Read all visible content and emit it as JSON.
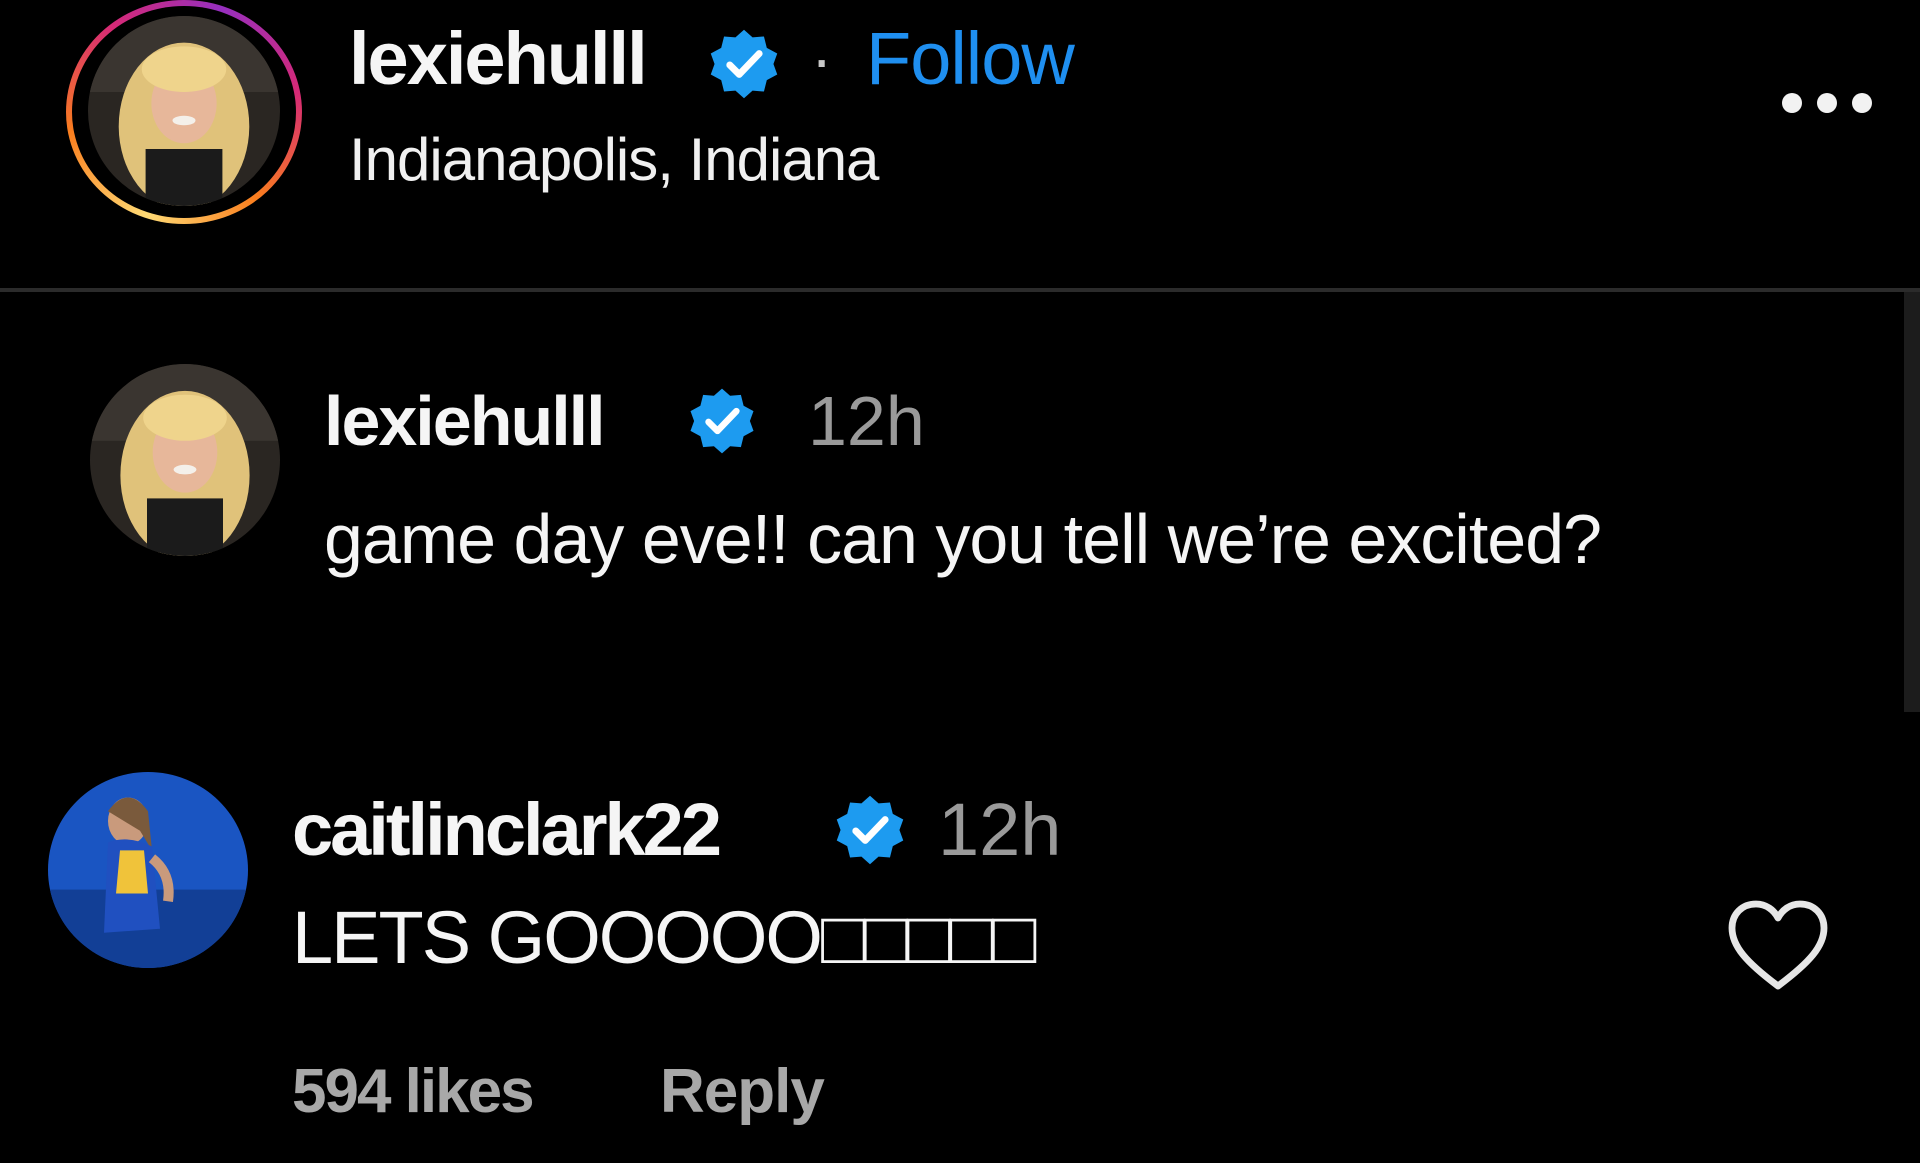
{
  "header": {
    "username": "lexiehulll",
    "separator": "·",
    "follow_label": "Follow",
    "location": "Indianapolis, Indiana",
    "more_icon": "more-options-icon",
    "verified_icon": "verified-badge-icon"
  },
  "caption": {
    "username": "lexiehulll",
    "time": "12h",
    "text": "game day eve!! can you tell we’re excited?"
  },
  "comment": {
    "username": "caitlinclark22",
    "time": "12h",
    "text": "LETS GOOOOO□□□□□",
    "likes": "594 likes",
    "reply_label": "Reply",
    "like_icon": "heart-icon"
  },
  "colors": {
    "background": "#000000",
    "text": "#f5f5f5",
    "muted": "#9a9a9a",
    "follow": "#1f8ff0",
    "verified": "#1d9bf0"
  }
}
